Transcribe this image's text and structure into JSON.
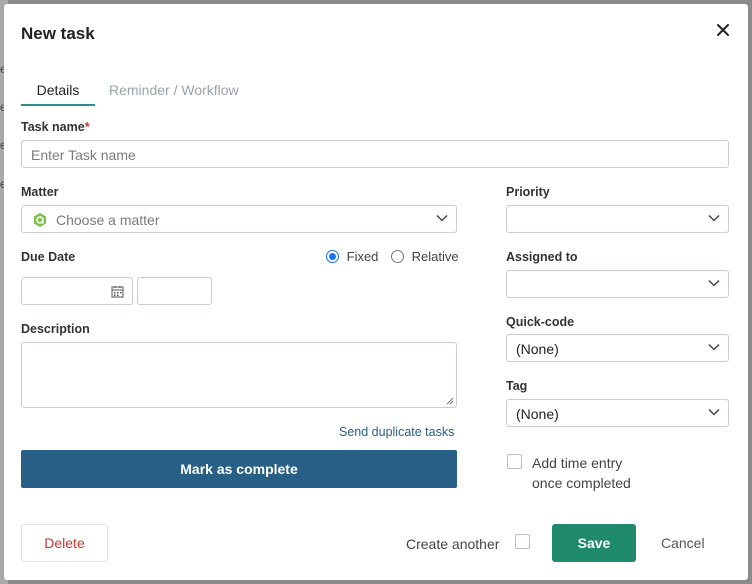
{
  "dialog": {
    "title": "New task"
  },
  "tabs": [
    {
      "label": "Details"
    },
    {
      "label": "Reminder / Workflow"
    }
  ],
  "task_name": {
    "label": "Task name",
    "required_mark": "*",
    "placeholder": "Enter Task name"
  },
  "matter": {
    "label": "Matter",
    "placeholder": "Choose a matter"
  },
  "priority": {
    "label": "Priority",
    "value": ""
  },
  "due_date": {
    "label": "Due Date",
    "options": [
      {
        "label": "Fixed",
        "checked": true
      },
      {
        "label": "Relative",
        "checked": false
      }
    ]
  },
  "assigned_to": {
    "label": "Assigned to",
    "value": ""
  },
  "quick_code": {
    "label": "Quick-code",
    "value": "(None)"
  },
  "description": {
    "label": "Description"
  },
  "tag": {
    "label": "Tag",
    "value": "(None)"
  },
  "links": {
    "send_duplicate": "Send duplicate tasks"
  },
  "buttons": {
    "mark_complete": "Mark as complete",
    "delete": "Delete",
    "save": "Save",
    "cancel": "Cancel"
  },
  "time_entry": {
    "line1": "Add time entry",
    "line2": "once completed",
    "checked": false
  },
  "create_another": {
    "label": "Create another",
    "checked": false
  },
  "backdrop": {
    "letters": [
      "e",
      "e",
      "e",
      "e"
    ]
  },
  "colors": {
    "accent_tab": "#2a8c8c",
    "primary_button": "#275f87",
    "save_button": "#1e8a6b",
    "danger": "#d0342c"
  }
}
